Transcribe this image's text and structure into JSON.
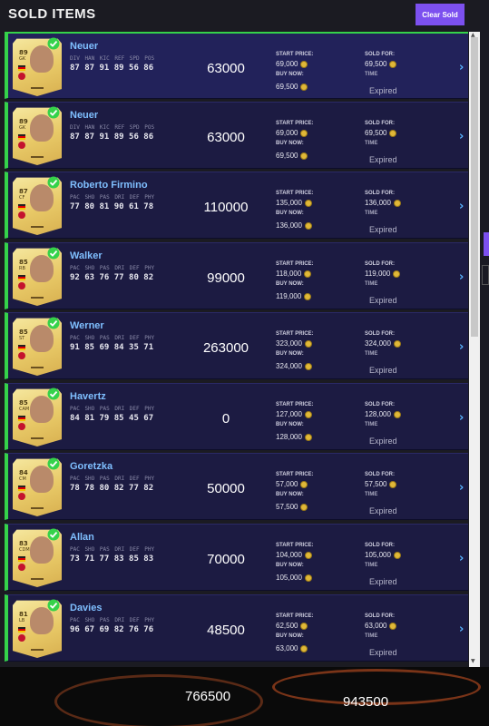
{
  "header": {
    "title": "SOLD ITEMS",
    "clear_label": "Clear Sold"
  },
  "labels": {
    "start_price": "START PRICE:",
    "buy_now": "BUY NOW:",
    "sold_for": "SOLD FOR:",
    "time": "TIME"
  },
  "items": [
    {
      "name": "Neuer",
      "rating": "89",
      "position": "GK",
      "stat_labels": "DIV HAN KIC REF SPD POS",
      "stat_values": "87 87 91 89 56 86",
      "value": "63000",
      "start_price": "69,000",
      "buy_now": "69,500",
      "sold_for": "69,500",
      "status": "Expired"
    },
    {
      "name": "Neuer",
      "rating": "89",
      "position": "GK",
      "stat_labels": "DIV HAN KIC REF SPD POS",
      "stat_values": "87 87 91 89 56 86",
      "value": "63000",
      "start_price": "69,000",
      "buy_now": "69,500",
      "sold_for": "69,500",
      "status": "Expired"
    },
    {
      "name": "Roberto Firmino",
      "rating": "87",
      "position": "CF",
      "stat_labels": "PAC SHO PAS DRI DEF PHY",
      "stat_values": "77 80 81 90 61 78",
      "value": "110000",
      "start_price": "135,000",
      "buy_now": "136,000",
      "sold_for": "136,000",
      "status": "Expired"
    },
    {
      "name": "Walker",
      "rating": "85",
      "position": "RB",
      "stat_labels": "PAC SHO PAS DRI DEF PHY",
      "stat_values": "92 63 76 77 80 82",
      "value": "99000",
      "start_price": "118,000",
      "buy_now": "119,000",
      "sold_for": "119,000",
      "status": "Expired"
    },
    {
      "name": "Werner",
      "rating": "85",
      "position": "ST",
      "stat_labels": "PAC SHO PAS DRI DEF PHY",
      "stat_values": "91 85 69 84 35 71",
      "value": "263000",
      "start_price": "323,000",
      "buy_now": "324,000",
      "sold_for": "324,000",
      "status": "Expired"
    },
    {
      "name": "Havertz",
      "rating": "85",
      "position": "CAM",
      "stat_labels": "PAC SHO PAS DRI DEF PHY",
      "stat_values": "84 81 79 85 45 67",
      "value": "0",
      "start_price": "127,000",
      "buy_now": "128,000",
      "sold_for": "128,000",
      "status": "Expired"
    },
    {
      "name": "Goretzka",
      "rating": "84",
      "position": "CM",
      "stat_labels": "PAC SHO PAS DRI DEF PHY",
      "stat_values": "78 78 80 82 77 82",
      "value": "50000",
      "start_price": "57,000",
      "buy_now": "57,500",
      "sold_for": "57,500",
      "status": "Expired"
    },
    {
      "name": "Allan",
      "rating": "83",
      "position": "CDM",
      "stat_labels": "PAC SHO PAS DRI DEF PHY",
      "stat_values": "73 71 77 83 85 83",
      "value": "70000",
      "start_price": "104,000",
      "buy_now": "105,000",
      "sold_for": "105,000",
      "status": "Expired"
    },
    {
      "name": "Davies",
      "rating": "81",
      "position": "LB",
      "stat_labels": "PAC SHO PAS DRI DEF PHY",
      "stat_values": "96 67 69 82 76 76",
      "value": "48500",
      "start_price": "62,500",
      "buy_now": "63,000",
      "sold_for": "63,000",
      "status": "Expired"
    }
  ],
  "totals": {
    "left": "766500",
    "right": "943500"
  },
  "colors": {
    "accent": "#7c50ef",
    "sold_border": "#35d24a",
    "name_blue": "#7fbfff",
    "coin": "#e0b838"
  }
}
